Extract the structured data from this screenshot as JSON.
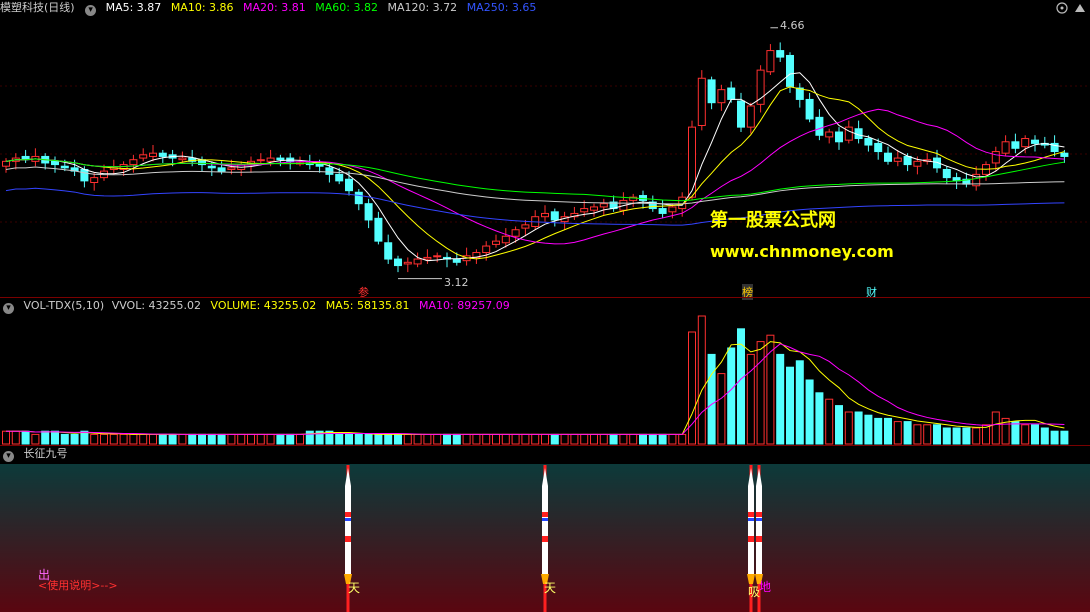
{
  "price_panel": {
    "stock": "模塑科技(日线)",
    "ma": [
      {
        "label": "MA5: 3.87",
        "color": "#ffffff"
      },
      {
        "label": "MA10: 3.86",
        "color": "#ffff00"
      },
      {
        "label": "MA20: 3.81",
        "color": "#ff00ff"
      },
      {
        "label": "MA60: 3.82",
        "color": "#00ff00"
      },
      {
        "label": "MA120: 3.72",
        "color": "#cccccc"
      },
      {
        "label": "MA250: 3.65",
        "color": "#0000ff"
      }
    ],
    "high_label": "4.66",
    "low_label": "3.12",
    "markers": [
      "参",
      "榜",
      "财"
    ],
    "watermark_title": "第一股票公式网",
    "watermark_url": "www.chnmoney.com"
  },
  "volume_panel": {
    "name": "VOL-TDX(5,10)",
    "vvol": "VVOL: 43255.02",
    "volume": "VOLUME: 43255.02",
    "ma5": "MA5: 58135.81",
    "ma10": "MA10: 89257.09"
  },
  "indicator_panel": {
    "name": "长征九号",
    "out_label": "出",
    "usage_label": "<使用说明>-->",
    "signal_labels": [
      "天",
      "天",
      "吸",
      "地"
    ]
  },
  "chart_data": [
    {
      "type": "candlestick",
      "title": "模塑科技(日线)",
      "ylim": [
        3.05,
        4.72
      ],
      "annotations": {
        "high": 4.66,
        "low": 3.12
      },
      "candles": [],
      "close": [
        3.84,
        3.86,
        3.85,
        3.87,
        3.83,
        3.82,
        3.8,
        3.78,
        3.72,
        3.74,
        3.78,
        3.8,
        3.82,
        3.85,
        3.88,
        3.89,
        3.87,
        3.86,
        3.86,
        3.84,
        3.82,
        3.8,
        3.78,
        3.8,
        3.82,
        3.84,
        3.85,
        3.86,
        3.85,
        3.84,
        3.83,
        3.82,
        3.81,
        3.76,
        3.72,
        3.66,
        3.58,
        3.48,
        3.35,
        3.24,
        3.2,
        3.22,
        3.24,
        3.25,
        3.26,
        3.24,
        3.22,
        3.26,
        3.28,
        3.32,
        3.35,
        3.38,
        3.42,
        3.45,
        3.5,
        3.52,
        3.48,
        3.5,
        3.52,
        3.55,
        3.56,
        3.58,
        3.55,
        3.6,
        3.62,
        3.6,
        3.55,
        3.52,
        3.56,
        3.62,
        4.05,
        4.35,
        4.2,
        4.28,
        4.22,
        4.05,
        4.18,
        4.4,
        4.52,
        4.48,
        4.3,
        4.22,
        4.1,
        4.0,
        4.02,
        3.96,
        4.05,
        3.98,
        3.94,
        3.9,
        3.84,
        3.86,
        3.82,
        3.84,
        3.85,
        3.8,
        3.74,
        3.72,
        3.7,
        3.76,
        3.82,
        3.9,
        3.96,
        3.92,
        3.98,
        3.95,
        3.94,
        3.9,
        3.87
      ]
    },
    {
      "type": "bar",
      "title": "VOL-TDX(5,10)",
      "values": [
        4,
        4,
        4,
        3,
        4,
        4,
        3,
        3,
        4,
        3,
        3,
        3,
        3,
        3,
        3,
        3,
        3,
        3,
        3,
        3,
        3,
        3,
        3,
        3,
        3,
        3,
        3,
        3,
        3,
        3,
        3,
        4,
        4,
        4,
        3,
        3,
        3,
        3,
        3,
        3,
        3,
        3,
        3,
        3,
        3,
        3,
        3,
        3,
        3,
        3,
        3,
        3,
        3,
        3,
        3,
        3,
        3,
        3,
        3,
        3,
        3,
        3,
        3,
        3,
        3,
        3,
        3,
        3,
        3,
        3,
        35,
        40,
        28,
        22,
        30,
        36,
        28,
        32,
        34,
        28,
        24,
        26,
        20,
        16,
        14,
        12,
        10,
        10,
        9,
        8,
        8,
        7,
        7,
        6,
        6,
        6,
        5,
        5,
        5,
        5,
        6,
        10,
        8,
        7,
        6,
        6,
        5,
        4,
        4
      ]
    }
  ],
  "colors": {
    "up": "#ff3030",
    "down": "#54ffff",
    "grid": "#7a0000"
  }
}
